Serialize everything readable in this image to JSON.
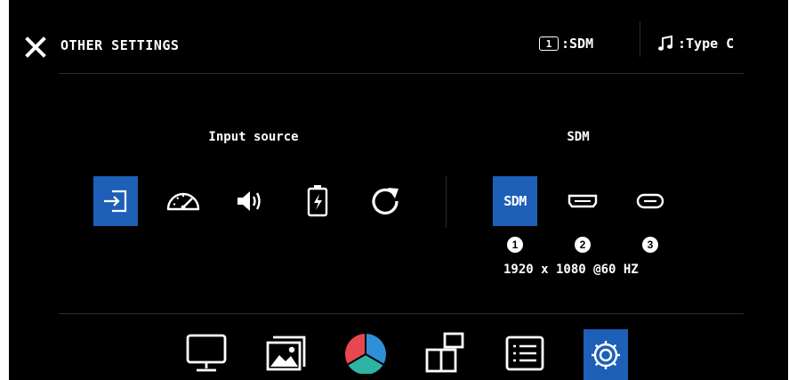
{
  "header": {
    "title": "OTHER SETTINGS",
    "source_badge": "1",
    "source_label": ":SDM",
    "audio_label": ":Type C"
  },
  "left_section": {
    "label": "Input source",
    "icons": [
      "input-source-icon",
      "speedometer-icon",
      "volume-icon",
      "battery-charging-icon",
      "refresh-icon"
    ],
    "selected": 0
  },
  "right_section": {
    "label": "SDM",
    "sdm_icon_text": "SDM",
    "ports": [
      "sdm",
      "hdmi",
      "usb-c"
    ],
    "port_numbers": [
      "1",
      "2",
      "3"
    ],
    "resolution": "1920 x 1080 @60 HZ",
    "selected": 0
  },
  "bottom_nav": {
    "items": [
      "monitor-icon",
      "image-icon",
      "color-wheel-icon",
      "multi-window-icon",
      "menu-list-icon",
      "settings-gear-icon"
    ],
    "selected": 5
  },
  "colors": {
    "selected_bg": "#1e5fb7",
    "background": "#000000",
    "divider": "#2c2c2c",
    "color_red": "#e8474f",
    "color_blue": "#2f8fd8",
    "color_green": "#2fb3a3"
  }
}
